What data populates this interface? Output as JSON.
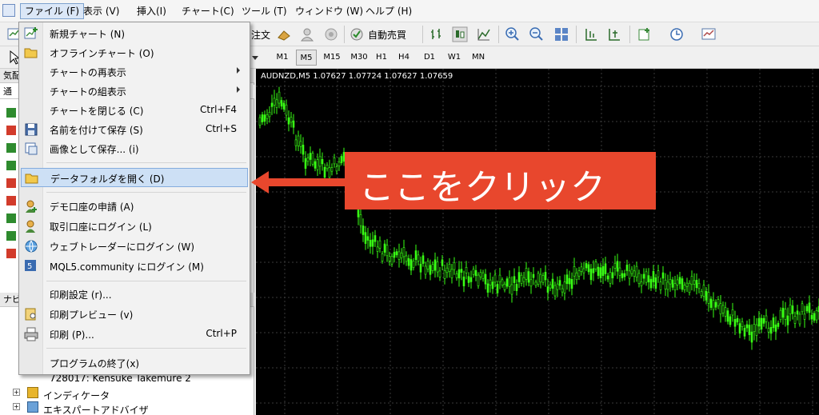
{
  "menubar": {
    "items": [
      "ファイル (F)",
      "表示 (V)",
      "挿入(I)",
      "チャート(C)",
      "ツール (T)",
      "ウィンドウ (W)",
      "ヘルプ (H)"
    ]
  },
  "toolbar": {
    "order_fragment": "注文",
    "auto_trade": "自動売買"
  },
  "timeframes": [
    "M1",
    "M5",
    "M15",
    "M30",
    "H1",
    "H4",
    "D1",
    "W1",
    "MN"
  ],
  "left_panel": {
    "market_watch_fragment": "気配",
    "tab_fragment": "通",
    "navigator_fragment": "ナビ",
    "account_line": "728017: Kensuke Takemure 2",
    "indicators": "インディケータ",
    "experts": "エキスパートアドバイザ"
  },
  "chart": {
    "title": "AUDNZD,M5  1.07627 1.07724 1.07627 1.07659"
  },
  "file_menu": {
    "items": [
      {
        "label": "新規チャート (N)",
        "shortcut": "",
        "icon": "new-chart-icon"
      },
      {
        "label": "オフラインチャート (O)",
        "shortcut": "",
        "icon": "open-folder-icon"
      },
      {
        "label": "チャートの再表示",
        "shortcut": "",
        "icon": ""
      },
      {
        "label": "チャートの組表示",
        "shortcut": "",
        "icon": ""
      },
      {
        "label": "チャートを閉じる (C)",
        "shortcut": "Ctrl+F4",
        "icon": ""
      },
      {
        "label": "名前を付けて保存 (S)",
        "shortcut": "Ctrl+S",
        "icon": "save-icon"
      },
      {
        "label": "画像として保存... (i)",
        "shortcut": "",
        "icon": "save-picture-icon"
      },
      {
        "label": "データフォルダを開く (D)",
        "shortcut": "",
        "icon": "data-folder-icon"
      },
      {
        "label": "デモ口座の申請 (A)",
        "shortcut": "",
        "icon": "demo-account-icon"
      },
      {
        "label": "取引口座にログイン (L)",
        "shortcut": "",
        "icon": "login-icon"
      },
      {
        "label": "ウェブトレーダーにログイン (W)",
        "shortcut": "",
        "icon": "web-trader-icon"
      },
      {
        "label": "MQL5.community にログイン (M)",
        "shortcut": "",
        "icon": "mql5-icon"
      },
      {
        "label": "印刷設定 (r)...",
        "shortcut": "",
        "icon": ""
      },
      {
        "label": "印刷プレビュー (v)",
        "shortcut": "",
        "icon": "print-preview-icon"
      },
      {
        "label": "印刷 (P)...",
        "shortcut": "Ctrl+P",
        "icon": "printer-icon"
      },
      {
        "label": "プログラムの終了(x)",
        "shortcut": "",
        "icon": ""
      }
    ]
  },
  "callout": {
    "text": "ここをクリック",
    "color": "#e8472d"
  },
  "colors": {
    "candles": "#39ff14",
    "chart_bg": "#000000",
    "highlight": "#cde0f5"
  }
}
